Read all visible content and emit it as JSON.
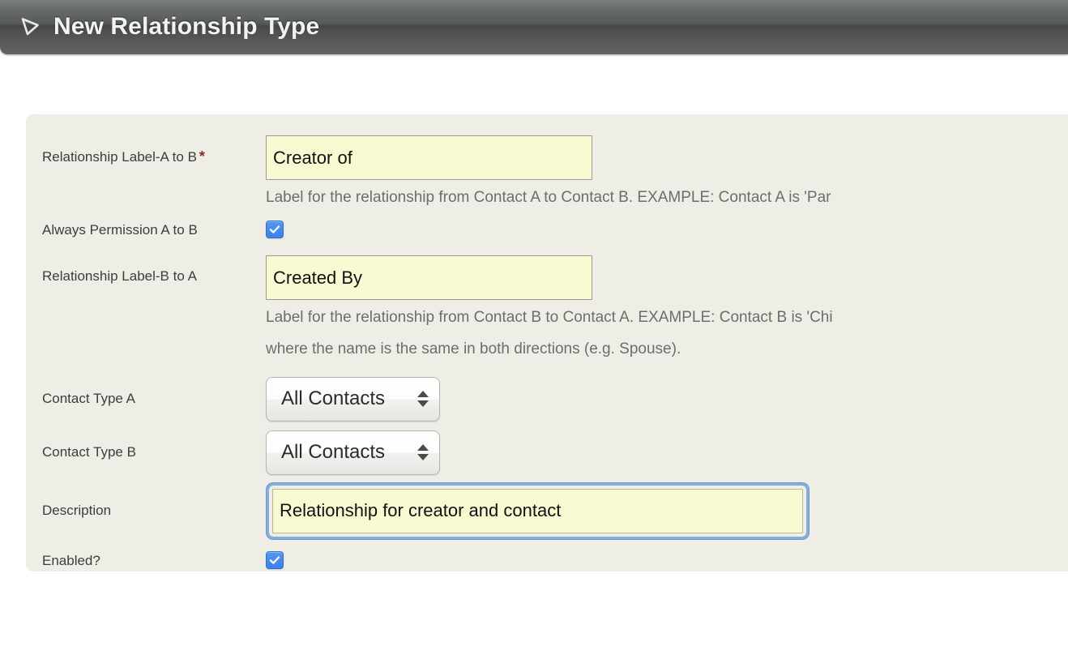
{
  "header": {
    "title": "New Relationship Type",
    "icon": "triangle-outline-icon"
  },
  "form": {
    "rows": {
      "label_a_to_b": {
        "label": "Relationship Label-A to B",
        "required_marker": "*",
        "value": "Creator of",
        "help": "Label for the relationship from Contact A to Contact B. EXAMPLE: Contact A is 'Par"
      },
      "always_permission": {
        "label": "Always Permission A to B",
        "checked": true
      },
      "label_b_to_a": {
        "label": "Relationship Label-B to A",
        "value": "Created By",
        "help_line1": "Label for the relationship from Contact B to Contact A. EXAMPLE: Contact B is 'Chi",
        "help_line2": "where the name is the same in both directions (e.g. Spouse)."
      },
      "contact_type_a": {
        "label": "Contact Type A",
        "selected": "All Contacts"
      },
      "contact_type_b": {
        "label": "Contact Type B",
        "selected": "All Contacts"
      },
      "description": {
        "label": "Description",
        "value": "Relationship for creator and contact"
      },
      "enabled": {
        "label": "Enabled?",
        "checked": true
      }
    }
  },
  "colors": {
    "panel_bg": "#eeeee6",
    "input_bg": "#fafad2",
    "checkbox_blue": "#3b82ef",
    "required_red": "#8b2b20",
    "focus_ring": "#86aedd",
    "header_dark": "#434546"
  }
}
